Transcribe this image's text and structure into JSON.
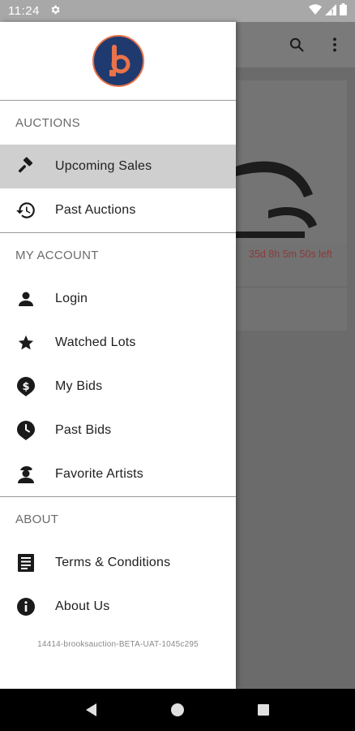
{
  "status_bar": {
    "time": "11:24",
    "icons": [
      "gear-icon",
      "wifi-icon",
      "signal-icon",
      "battery-icon"
    ]
  },
  "background": {
    "card_time_left": "35d 8h 5m 50s left",
    "toolbar_icons": [
      "search-icon",
      "more-vert-icon"
    ]
  },
  "drawer": {
    "logo_letter": "b",
    "sections": [
      {
        "title": "AUCTIONS",
        "items": [
          {
            "label": "Upcoming Sales",
            "icon": "gavel-icon",
            "active": true
          },
          {
            "label": "Past Auctions",
            "icon": "history-icon",
            "active": false
          }
        ]
      },
      {
        "title": "MY ACCOUNT",
        "items": [
          {
            "label": "Login",
            "icon": "person-icon"
          },
          {
            "label": "Watched Lots",
            "icon": "star-icon"
          },
          {
            "label": "My Bids",
            "icon": "dollar-pin-icon"
          },
          {
            "label": "Past Bids",
            "icon": "clock-pin-icon"
          },
          {
            "label": "Favorite Artists",
            "icon": "artist-icon"
          }
        ]
      },
      {
        "title": "ABOUT",
        "items": [
          {
            "label": "Terms & Conditions",
            "icon": "document-icon"
          },
          {
            "label": "About Us",
            "icon": "info-icon"
          }
        ]
      }
    ],
    "version": "14414-brooksauction-BETA-UAT-1045c295"
  },
  "nav_bar": {
    "buttons": [
      "back-icon",
      "home-icon",
      "recents-icon"
    ]
  },
  "colors": {
    "logo_bg": "#1f3a6e",
    "logo_accent": "#e8734a",
    "active_item_bg": "#cfcfcf",
    "time_left_text": "#8e3a3a"
  }
}
